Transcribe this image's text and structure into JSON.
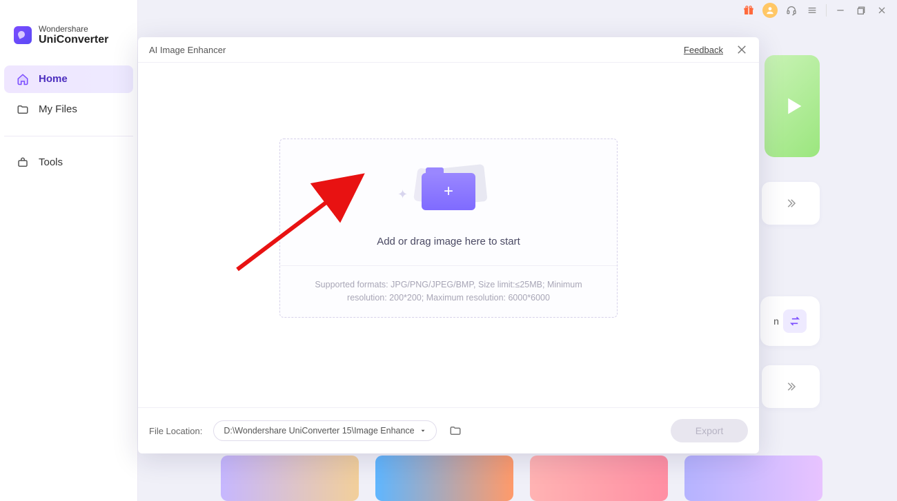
{
  "app": {
    "brand_small": "Wondershare",
    "brand_big": "UniConverter"
  },
  "sidebar": {
    "items": [
      {
        "label": "Home",
        "active": true
      },
      {
        "label": "My Files",
        "active": false
      },
      {
        "label": "Tools",
        "active": false
      }
    ]
  },
  "modal": {
    "title": "AI Image Enhancer",
    "feedback": "Feedback",
    "dropzone": {
      "main_text": "Add or drag image here to start",
      "support_text": "Supported formats: JPG/PNG/JPEG/BMP, Size limit:≤25MB; Minimum resolution: 200*200; Maximum resolution: 6000*6000"
    },
    "footer": {
      "location_label": "File Location:",
      "path": "D:\\Wondershare UniConverter 15\\Image Enhance",
      "export_label": "Export"
    }
  },
  "bg": {
    "switch_label_fragment": "n"
  }
}
